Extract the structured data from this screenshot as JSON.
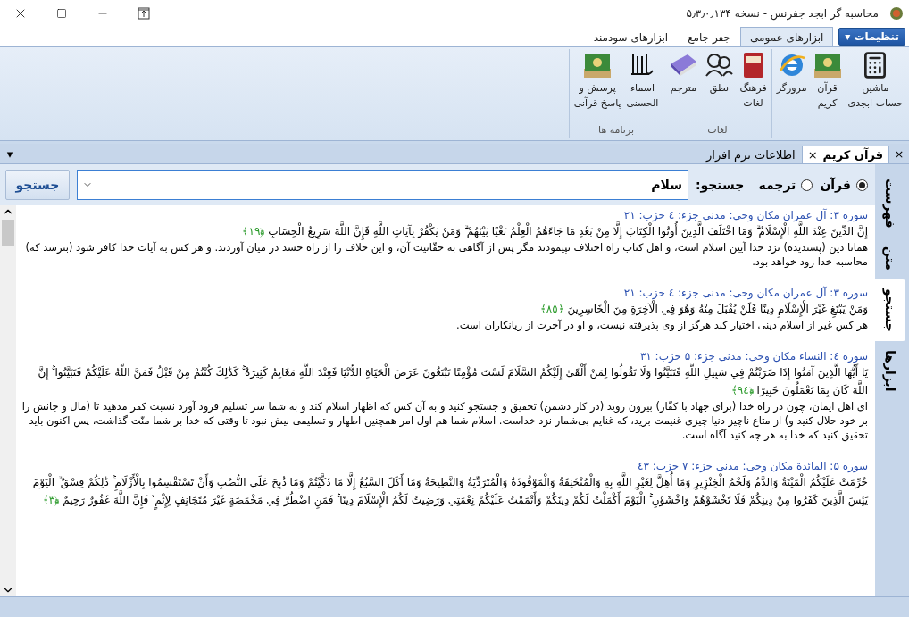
{
  "window": {
    "title": "محاسبه گر ابجد جفرنس - نسخه ۵٫۳٫۰٫۱۳۴"
  },
  "ribbon": {
    "app_menu": {
      "label": "تنظیمات",
      "caret": "▾"
    },
    "tabs": [
      {
        "label": "ابزارهای عمومی",
        "selected": true
      },
      {
        "label": "جفر جامع",
        "selected": false
      },
      {
        "label": "ابزارهای سودمند",
        "selected": false
      }
    ],
    "groups": [
      {
        "items": [
          {
            "kind": "calculator",
            "lines": [
              "ماشین",
              "حساب ابجدی"
            ]
          },
          {
            "kind": "quran",
            "lines": [
              "قرآن",
              "کریم"
            ]
          },
          {
            "kind": "browser",
            "lines": [
              "مرورگر"
            ]
          }
        ]
      },
      {
        "label": "لغات",
        "items": [
          {
            "kind": "dictionary",
            "lines": [
              "فرهنگ",
              "لغات"
            ]
          },
          {
            "kind": "speech",
            "lines": [
              "نطق"
            ]
          },
          {
            "kind": "translator",
            "lines": [
              "مترجم"
            ]
          }
        ]
      },
      {
        "label": "برنامه ها",
        "items": [
          {
            "kind": "names",
            "lines": [
              "اسماء",
              "الحسنی"
            ]
          },
          {
            "kind": "quran",
            "lines": [
              "پرسش و",
              "پاسخ قرآنی"
            ]
          }
        ]
      }
    ]
  },
  "doc_tabs": [
    {
      "label": "قرآن کریم",
      "selected": true,
      "close": "×"
    },
    {
      "label": "اطلاعات نرم افزار",
      "selected": false
    }
  ],
  "pane_close": "×",
  "pane_menu": "▾",
  "side_tabs": [
    {
      "label": "فهرست",
      "selected": false
    },
    {
      "label": "متن",
      "selected": false
    },
    {
      "label": "جستجو",
      "selected": true
    },
    {
      "label": "ابزارها",
      "selected": false
    }
  ],
  "search": {
    "modes": [
      {
        "label": "قرآن",
        "selected": true
      },
      {
        "label": "ترجمه",
        "selected": false
      }
    ],
    "label": "جستجو:",
    "value": "سلام",
    "button": "جستجو"
  },
  "results": [
    {
      "header": "سوره ۳: آل عمران مکان وحی: مدنی جزء: ٤ حزب: ۲۱",
      "ayah": "إِنَّ الدِّينَ عِنْدَ اللَّهِ الْإِسْلَامُ ۗ وَمَا اخْتَلَفَ الَّذِينَ أُوتُوا الْكِتَابَ إِلَّا مِنْ بَعْدِ مَا جَاءَهُمُ الْعِلْمُ بَغْيًا بَيْنَهُمْ ۗ وَمَنْ يَكْفُرْ بِآيَاتِ اللَّهِ فَإِنَّ اللَّهَ سَرِيعُ الْحِسَابِ",
      "number": "﴿١٩﴾",
      "translation": "همانا دین (پسندیده) نزد خدا آیین اسلام است، و اهل کتاب راه اختلاف نپیمودند مگر پس از آگاهی به حقّانیت آن، و این خلاف را از راه حسد در میان آوردند. و هر کس به آیات خدا کافر شود (بترسد که) محاسبه خدا زود خواهد بود."
    },
    {
      "header": "سوره ۳: آل عمران مکان وحی: مدنی جزء: ٤ حزب: ۲۱",
      "ayah": "وَمَنْ يَبْتَغِ غَيْرَ الْإِسْلَامِ دِينًا فَلَنْ يُقْبَلَ مِنْهُ وَهُوَ فِي الْآخِرَةِ مِنَ الْخَاسِرِينَ",
      "number": "﴿٨٥﴾",
      "translation": "هر کس غیر از اسلام دینی اختیار کند هرگز از وی پذیرفته نیست، و او در آخرت از زیانکاران است."
    },
    {
      "header": "سوره ٤: النساء مکان وحی: مدنی جزء: ۵ حزب: ۳۱",
      "ayah": "يَا أَيُّهَا الَّذِينَ آمَنُوا إِذَا ضَرَبْتُمْ فِي سَبِيلِ اللَّهِ فَتَبَيَّنُوا وَلَا تَقُولُوا لِمَنْ أَلْقَىٰ إِلَيْكُمُ السَّلَامَ لَسْتَ مُؤْمِنًا تَبْتَغُونَ عَرَضَ الْحَيَاةِ الدُّنْيَا فَعِنْدَ اللَّهِ مَغَانِمُ كَثِيرَةٌ ۚ كَذَٰلِكَ كُنْتُمْ مِنْ قَبْلُ فَمَنَّ اللَّهُ عَلَيْكُمْ فَتَبَيَّنُوا ۚ إِنَّ اللَّهَ كَانَ بِمَا تَعْمَلُونَ خَبِيرًا",
      "number": "﴿٩٤﴾",
      "translation": "ای اهل ایمان، چون در راه خدا (برای جهاد با کفّار) بیرون روید (در کار دشمن) تحقیق و جستجو کنید و به آن کس که اظهار اسلام کند و به شما سر تسلیم فرود آورد نسبت کفر مدهید تا (مال و جانش را بر خود حلال کنید و) از متاع ناچیز دنیا چیزی غنیمت برید، که غنایم بی‌شمار نزد خداست. اسلام شما هم اول امر همچنین اظهار و تسلیمی بیش نبود تا وقتی که خدا بر شما منّت گذاشت، پس اکنون باید تحقیق کنید که خدا به هر چه کنید آگاه است."
    },
    {
      "header": "سوره ۵: المائدة مکان وحی: مدنی جزء: ۷ حزب: ٤۳",
      "ayah": "حُرِّمَتْ عَلَيْكُمُ الْمَيْتَةُ وَالدَّمُ وَلَحْمُ الْخِنْزِيرِ وَمَا أُهِلَّ لِغَيْرِ اللَّهِ بِهِ وَالْمُنْخَنِقَةُ وَالْمَوْقُوذَةُ وَالْمُتَرَدِّيَةُ وَالنَّطِيحَةُ وَمَا أَكَلَ السَّبُعُ إِلَّا مَا ذَكَّيْتُمْ وَمَا ذُبِحَ عَلَى النُّصُبِ وَأَنْ تَسْتَقْسِمُوا بِالْأَزْلَامِ ۚ ذَٰلِكُمْ فِسْقٌ ۗ الْيَوْمَ يَئِسَ الَّذِينَ كَفَرُوا مِنْ دِينِكُمْ فَلَا تَخْشَوْهُمْ وَاخْشَوْنِ ۚ الْيَوْمَ أَكْمَلْتُ لَكُمْ دِينَكُمْ وَأَتْمَمْتُ عَلَيْكُمْ نِعْمَتِي وَرَضِيتُ لَكُمُ الْإِسْلَامَ دِينًا ۚ فَمَنِ اضْطُرَّ فِي مَخْمَصَةٍ غَيْرَ مُتَجَانِفٍ لِإِثْمٍ ۙ فَإِنَّ اللَّهَ غَفُورٌ رَحِيمٌ",
      "number": "﴿٣﴾"
    }
  ]
}
